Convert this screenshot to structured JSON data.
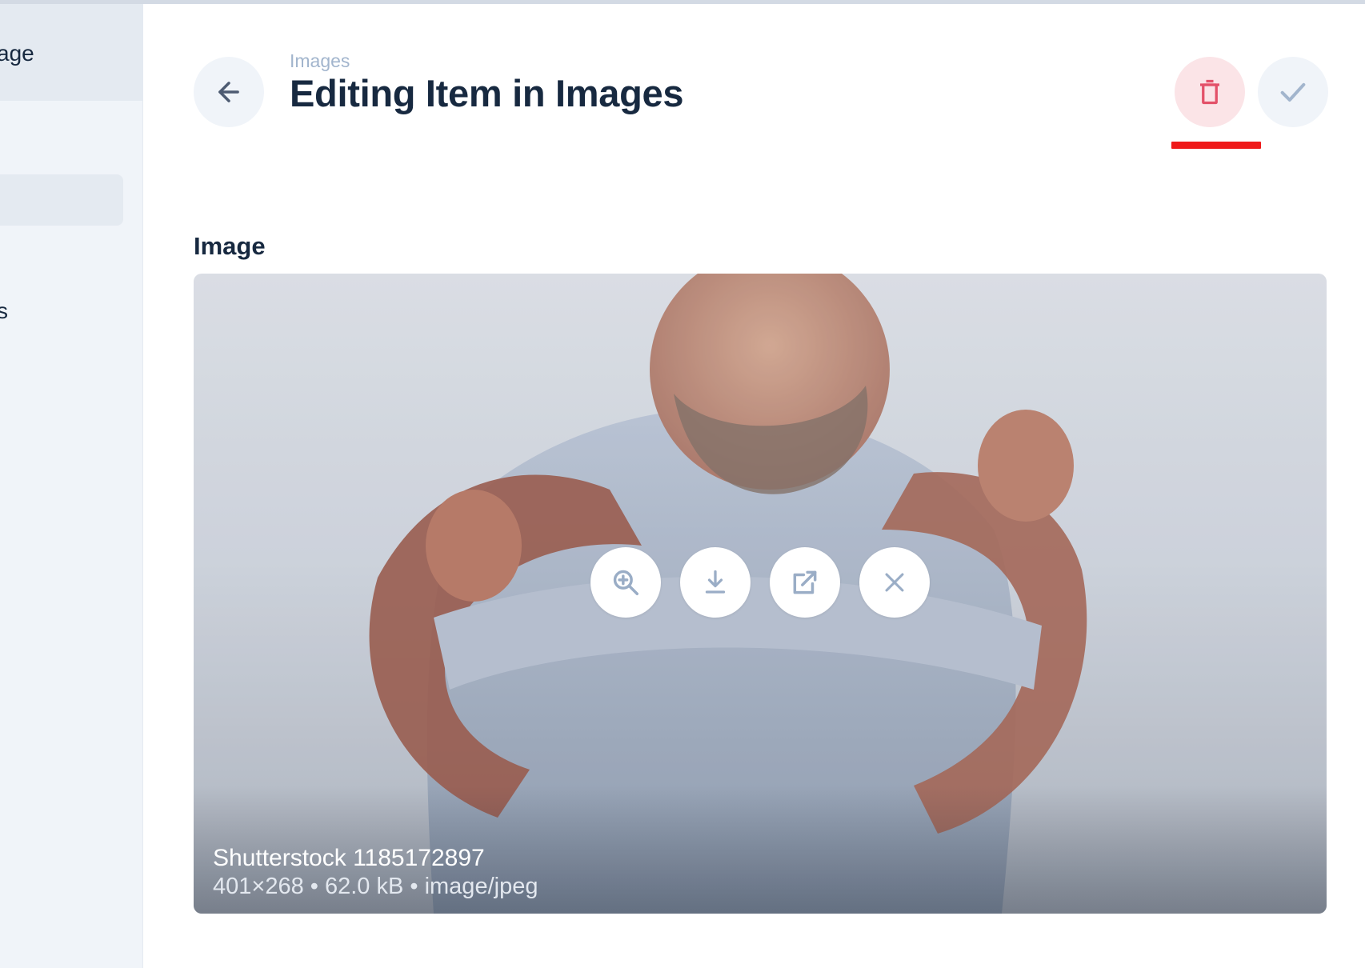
{
  "sidebar": {
    "items": [
      {
        "label": "age",
        "active": true
      },
      {
        "label": "",
        "active": false,
        "highlighted": true
      },
      {
        "label": "s",
        "active": false
      }
    ]
  },
  "header": {
    "breadcrumb": "Images",
    "title": "Editing Item in Images",
    "back_icon": "arrow-left-icon",
    "delete_icon": "trash-icon",
    "save_icon": "check-icon"
  },
  "field": {
    "label": "Image"
  },
  "image": {
    "title": "Shutterstock 1185172897",
    "meta": "401×268 • 62.0 kB • image/jpeg",
    "actions": [
      "zoom-in-icon",
      "download-icon",
      "open-external-icon",
      "close-icon"
    ]
  },
  "colors": {
    "accent_danger": "#e35169",
    "danger_bg": "#fbe4e7",
    "muted": "#a2b5cd",
    "title": "#172940",
    "highlight": "#ef1a1a"
  }
}
